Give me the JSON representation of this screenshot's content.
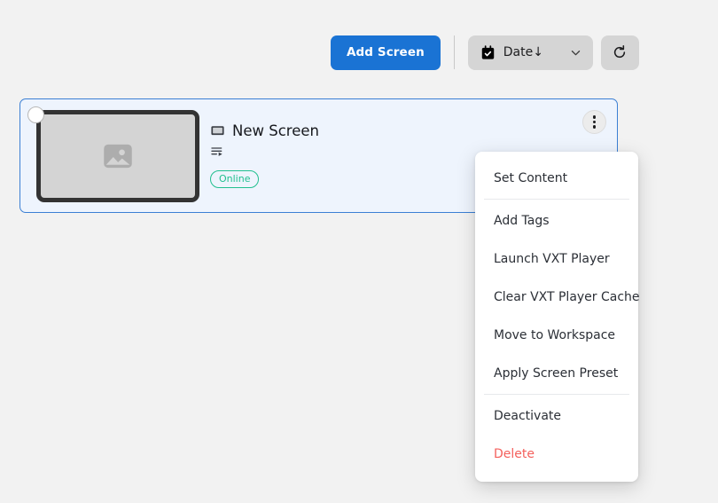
{
  "toolbar": {
    "add_screen_label": "Add Screen",
    "sort_icon": "calendar-check-icon",
    "sort_label": "Date↓",
    "chevron_icon": "chevron-down-icon",
    "refresh_icon": "refresh-icon"
  },
  "card": {
    "select_checkbox": "screen-select-checkbox",
    "thumbnail_icon": "image-placeholder-icon",
    "display_icon": "monitor-icon",
    "title": "New Screen",
    "playlist_icon": "playlist-play-icon",
    "status": "Online",
    "status_color": "#21bf8f",
    "kebab_icon": "more-vertical-icon"
  },
  "context_menu": {
    "items": [
      {
        "label": "Set Content",
        "danger": false
      },
      {
        "label": "Add Tags",
        "danger": false
      },
      {
        "label": "Launch VXT Player",
        "danger": false
      },
      {
        "label": "Clear VXT Player Cache",
        "danger": false
      },
      {
        "label": "Move to Workspace",
        "danger": false
      },
      {
        "label": "Apply Screen Preset",
        "danger": false
      },
      {
        "label": "Deactivate",
        "danger": false
      },
      {
        "label": "Delete",
        "danger": true
      }
    ]
  },
  "colors": {
    "primary": "#1a73d4",
    "page_bg": "#f2f2f2",
    "card_bg": "#eef4fd",
    "danger": "#f4605c"
  }
}
